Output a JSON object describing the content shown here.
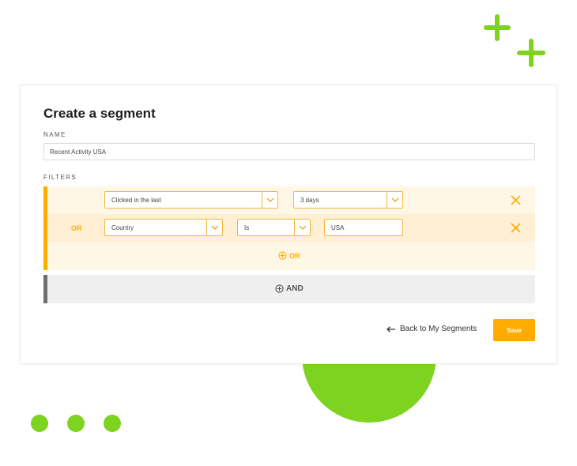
{
  "form": {
    "title": "Create a segment",
    "name_label": "NAME",
    "name_value": "Recent Activity USA",
    "filters_label": "FILTERS"
  },
  "filters": {
    "row1": {
      "field": "Clicked in the last",
      "period": "3 days"
    },
    "row2": {
      "connector": "OR",
      "field": "Country",
      "operator": "Is",
      "value": "USA"
    },
    "add_or_label": "OR",
    "add_and_label": "AND"
  },
  "actions": {
    "back_label": "Back to My Segments",
    "save_label": "Save"
  },
  "colors": {
    "accent": "#ffab00",
    "decor_green": "#7ed321",
    "and_bar": "#6f6f6f"
  },
  "icons": [
    "plus-decor-icon",
    "chevron-down-icon",
    "close-icon",
    "add-circle-icon",
    "arrow-left-icon"
  ]
}
